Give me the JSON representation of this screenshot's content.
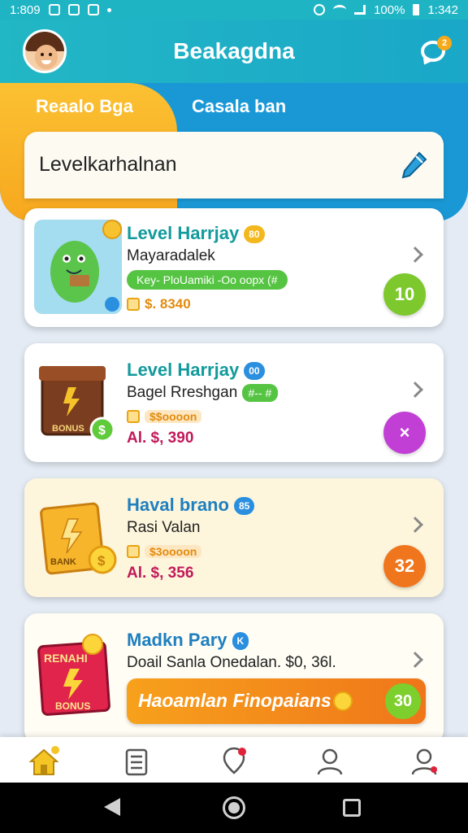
{
  "status_bar": {
    "time_left": "1:809",
    "battery": "100%",
    "time_right": "1:342"
  },
  "header": {
    "title": "Beakagdna",
    "notification_count": "2"
  },
  "tabs": [
    {
      "label": "Reaalo Bga",
      "active": true
    },
    {
      "label": "Casala ban",
      "active": false
    }
  ],
  "section": {
    "title": "Levelkarhalnan"
  },
  "cards": [
    {
      "title": "Level Harrjay",
      "title_chip": "80",
      "subtitle": "Mayaradalek",
      "tag": "Key- PloUamiki -Oo oopx (#",
      "price": "$. 8340",
      "action_value": "10",
      "action_color": "#7dc92d"
    },
    {
      "title": "Level Harrjay",
      "title_chip": "00",
      "subtitle": "Bagel Rreshgan",
      "subtitle_tag": "#-- #",
      "price_badge": "$$oooon",
      "price": "Al. $, 390",
      "action_value": "×",
      "action_color": "#c23fd6",
      "thumb_text": "BONUS"
    },
    {
      "title": "Haval brano",
      "title_chip": "85",
      "subtitle": "Rasi Valan",
      "price_badge": "$3oooon",
      "price": "Al. $, 356",
      "action_value": "32",
      "action_color": "#f0761e",
      "thumb_text": "BANK"
    },
    {
      "title": "Madkn Pary",
      "title_chip": "K",
      "subtitle": "Doail Sanla Onedalan. $0, 36l.",
      "cta_label": "Haoamlan Finopaians",
      "cta_value": "30",
      "thumb_text_top": "RENAHI",
      "thumb_text_bottom": "BONUS"
    }
  ],
  "bottom_nav": [
    {
      "icon": "home-icon",
      "active": true
    },
    {
      "icon": "document-icon",
      "active": false
    },
    {
      "icon": "pin-icon",
      "active": false
    },
    {
      "icon": "profile-icon",
      "active": false
    },
    {
      "icon": "account-icon",
      "active": false
    }
  ],
  "colors": {
    "header": "#1fb4c4",
    "tab_active": "#f7a71e",
    "tab_band": "#1a98d6",
    "accent_teal": "#139a9c"
  }
}
